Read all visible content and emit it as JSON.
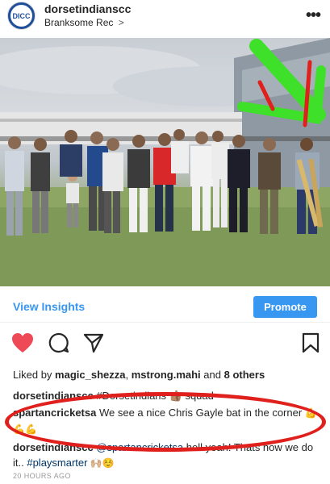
{
  "header": {
    "username": "dorsetindianscc",
    "location": "Branksome Rec",
    "location_chevron": ">",
    "more": "•••",
    "avatar_text": "DICC"
  },
  "insights": {
    "view_label": "View Insights",
    "promote_label": "Promote"
  },
  "likes": {
    "prefix": "Liked by ",
    "user1": "magic_shezza",
    "separator": ", ",
    "user2": "mstrong.mahi",
    "and": " and ",
    "others": "8 others"
  },
  "comments": [
    {
      "user": "dorsetindianscc",
      "text": " #Dorsetindians 👍🏽 squad"
    },
    {
      "user": "spartancricketsa",
      "text": " We see a nice Chris Gayle bat in the corner ",
      "emoji": "💪💪💪"
    },
    {
      "user": "dorsetindianscc",
      "mention": " @spartancricketsa",
      "text": " hell yeah! Thats how we do it.. ",
      "hashtag": "#playsmarter",
      "emoji": " 🙌🏼☺️"
    }
  ],
  "timestamp": "20 HOURS AGO",
  "colors": {
    "accent": "#3897f0",
    "heart": "#ed4956",
    "annotation_red": "#e0201c",
    "annotation_green": "#3ee02a"
  },
  "icons": [
    "heart-icon",
    "comment-icon",
    "share-icon",
    "bookmark-icon",
    "more-icon"
  ]
}
